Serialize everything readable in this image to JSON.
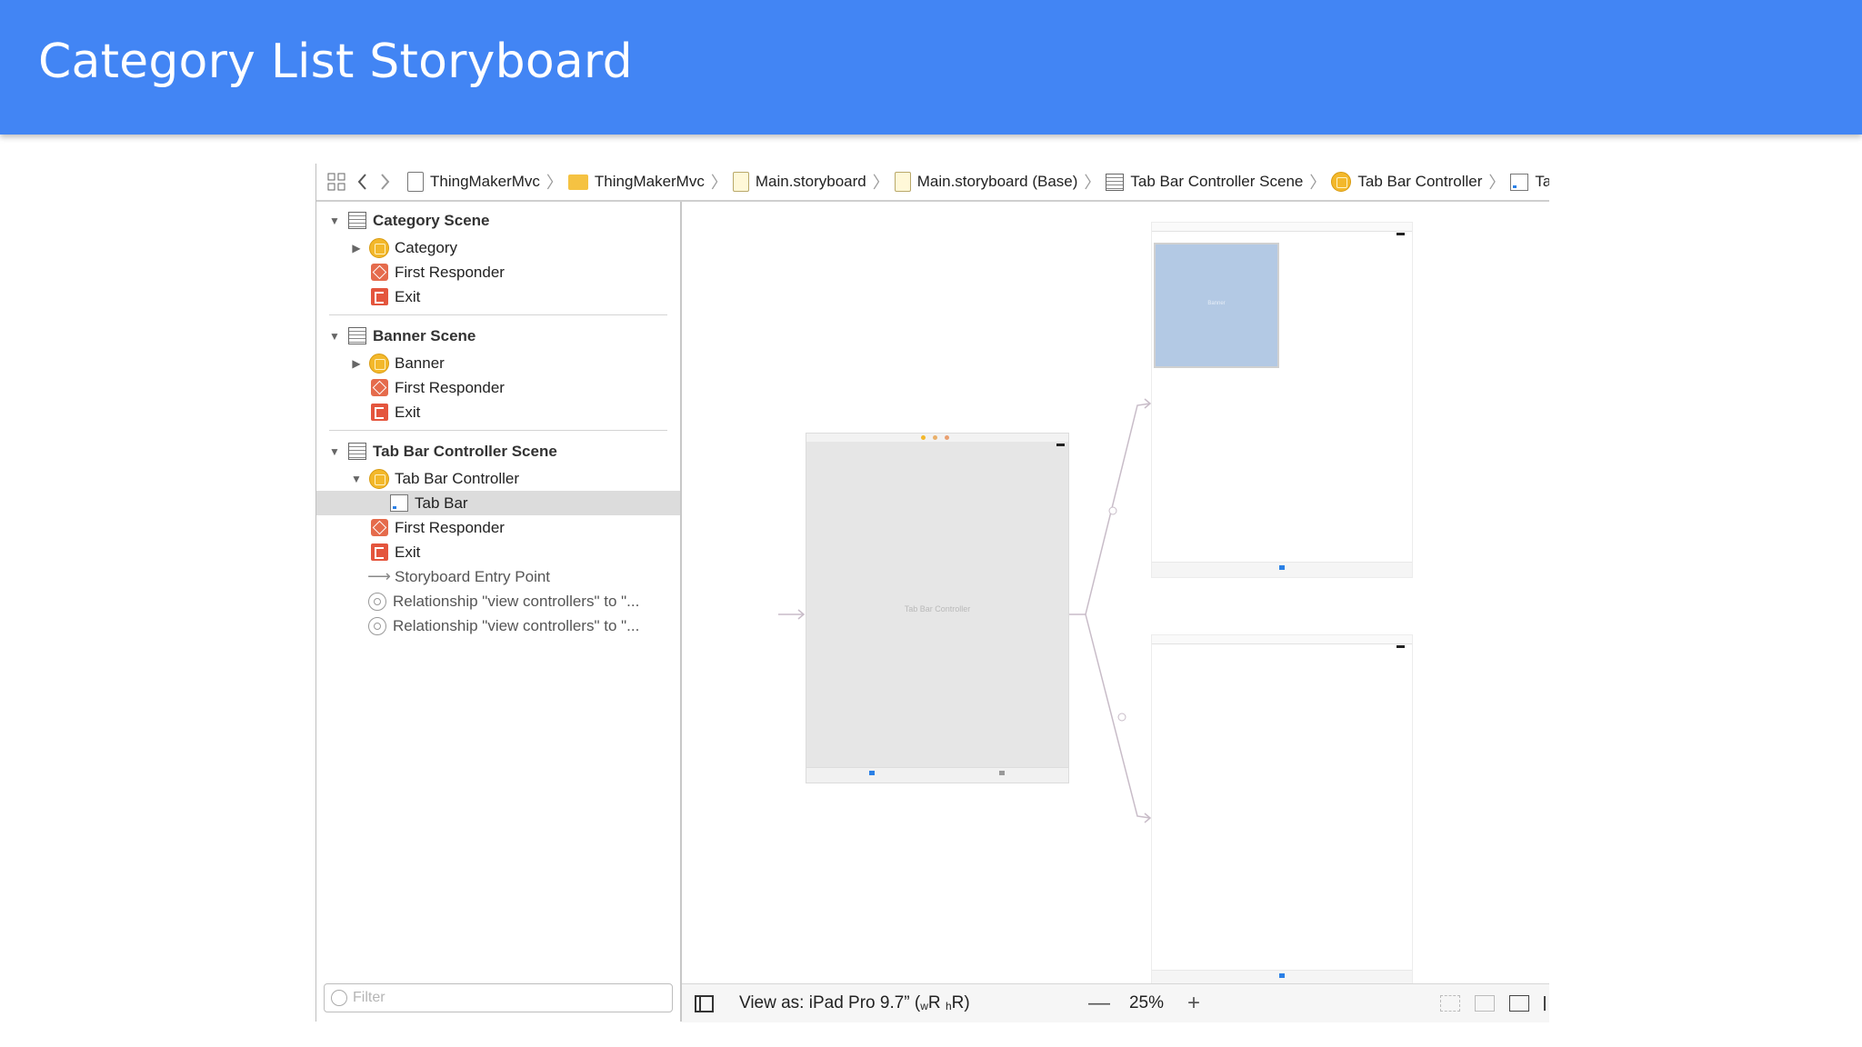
{
  "slide": {
    "title": "Category List Storyboard"
  },
  "jumpbar": {
    "crumbs": [
      {
        "label": "ThingMakerMvc",
        "icon": "project-file-icon"
      },
      {
        "label": "ThingMakerMvc",
        "icon": "folder-icon"
      },
      {
        "label": "Main.storyboard",
        "icon": "storyboard-file-icon"
      },
      {
        "label": "Main.storyboard (Base)",
        "icon": "storyboard-file-icon"
      },
      {
        "label": "Tab Bar Controller Scene",
        "icon": "scene-icon"
      },
      {
        "label": "Tab Bar Controller",
        "icon": "view-controller-icon"
      },
      {
        "label": "Tab",
        "icon": "tab-bar-icon"
      }
    ]
  },
  "outline": {
    "scenes": [
      {
        "name": "Category Scene",
        "items": [
          {
            "label": "Category",
            "icon": "view-controller-icon"
          },
          {
            "label": "First Responder",
            "icon": "first-responder-icon"
          },
          {
            "label": "Exit",
            "icon": "exit-icon"
          }
        ]
      },
      {
        "name": "Banner Scene",
        "items": [
          {
            "label": "Banner",
            "icon": "view-controller-icon"
          },
          {
            "label": "First Responder",
            "icon": "first-responder-icon"
          },
          {
            "label": "Exit",
            "icon": "exit-icon"
          }
        ]
      },
      {
        "name": "Tab Bar Controller Scene",
        "items": [
          {
            "label": "Tab Bar Controller",
            "icon": "view-controller-icon"
          },
          {
            "label": "Tab Bar",
            "icon": "tab-bar-icon",
            "selected": true
          },
          {
            "label": "First Responder",
            "icon": "first-responder-icon"
          },
          {
            "label": "Exit",
            "icon": "exit-icon"
          },
          {
            "label": "Storyboard Entry Point",
            "icon": "arrow-icon"
          },
          {
            "label": "Relationship \"view controllers\" to \"...",
            "icon": "relationship-icon"
          },
          {
            "label": "Relationship \"view controllers\" to \"...",
            "icon": "relationship-icon"
          }
        ]
      }
    ],
    "filter_placeholder": "Filter"
  },
  "canvas": {
    "tbc_label": "Tab Bar Controller",
    "banner_label": "Banner"
  },
  "bottombar": {
    "view_as": "View as: iPad Pro 9.7” (",
    "size_w": "w",
    "size_R1": "R",
    "size_h": "h",
    "size_R2": "R)",
    "zoom_minus": "—",
    "zoom": "25%",
    "zoom_plus": "+"
  },
  "colors": {
    "header_bg": "#4285f4",
    "selection": "#dcdcdc",
    "segue_line": "#c8bcc8",
    "banner_fill": "#b3c9e4"
  }
}
